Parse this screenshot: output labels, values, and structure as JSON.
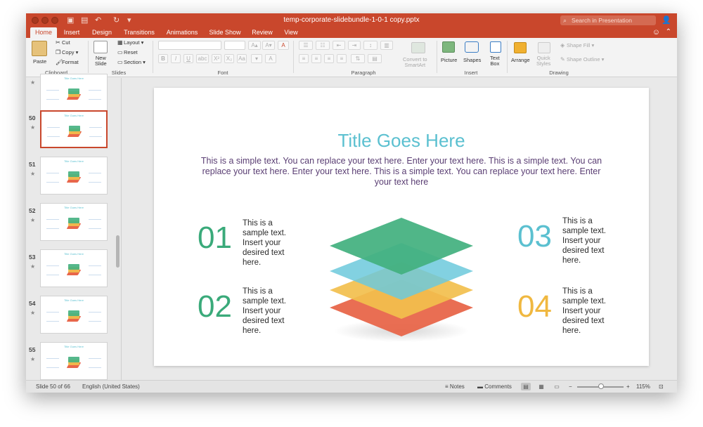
{
  "window": {
    "title": "temp-corporate-slidebundle-1-0-1 copy.pptx",
    "search_placeholder": "Search in Presentation"
  },
  "tabs": [
    "Home",
    "Insert",
    "Design",
    "Transitions",
    "Animations",
    "Slide Show",
    "Review",
    "View"
  ],
  "active_tab": "Home",
  "ribbon": {
    "paste": "Paste",
    "cut": "Cut",
    "copy": "Copy",
    "format": "Format",
    "new_slide_1": "New",
    "new_slide_2": "Slide",
    "layout": "Layout",
    "reset": "Reset",
    "section": "Section",
    "convert_1": "Convert to",
    "convert_2": "SmartArt",
    "picture": "Picture",
    "shapes": "Shapes",
    "text_box_1": "Text",
    "text_box_2": "Box",
    "arrange": "Arrange",
    "quick_styles_1": "Quick",
    "quick_styles_2": "Styles",
    "shape_fill": "Shape Fill",
    "shape_outline": "Shape Outline",
    "groups": {
      "clipboard": "Clipboard",
      "slides": "Slides",
      "font": "Font",
      "paragraph": "Paragraph",
      "insert": "Insert",
      "drawing": "Drawing"
    }
  },
  "thumbnails": [
    {
      "num": "",
      "title": "Title Goes Here",
      "offset": 0
    },
    {
      "num": "50",
      "title": "Title Goes Here",
      "offset": 1
    },
    {
      "num": "51",
      "title": "Title Goes Here",
      "offset": 2
    },
    {
      "num": "52",
      "title": "Title Goes Here",
      "offset": 3
    },
    {
      "num": "53",
      "title": "Title Goes Here",
      "offset": 4
    },
    {
      "num": "54",
      "title": "Title Goes Here",
      "offset": 5
    },
    {
      "num": "55",
      "title": "Title Goes Here",
      "offset": 6
    }
  ],
  "slide": {
    "title": "Title Goes Here",
    "body": "This is a simple text. You can replace your text here. Enter your text here. This is a simple text. You can replace your text here. Enter your text here. This is a simple text. You can replace your text here. Enter your text here",
    "items": [
      {
        "num": "01",
        "text": "This is a sample text. Insert your desired text here.",
        "color": "#3aaa7a"
      },
      {
        "num": "02",
        "text": "This is a sample text. Insert your desired text here.",
        "color": "#3aaa7a"
      },
      {
        "num": "03",
        "text": "This is a sample text. Insert your desired text here.",
        "color": "#5bc0d0"
      },
      {
        "num": "04",
        "text": "This is a sample text. Insert your desired text here.",
        "color": "#f0b840"
      }
    ],
    "layer_colors": [
      "#e8664a",
      "#f2bf4d",
      "#6cc9dc",
      "#43b07f"
    ]
  },
  "status": {
    "slide_info": "Slide 50 of 66",
    "language": "English (United States)",
    "notes": "Notes",
    "comments": "Comments",
    "zoom": "115%"
  },
  "colors": {
    "accent": "#c9472c"
  }
}
